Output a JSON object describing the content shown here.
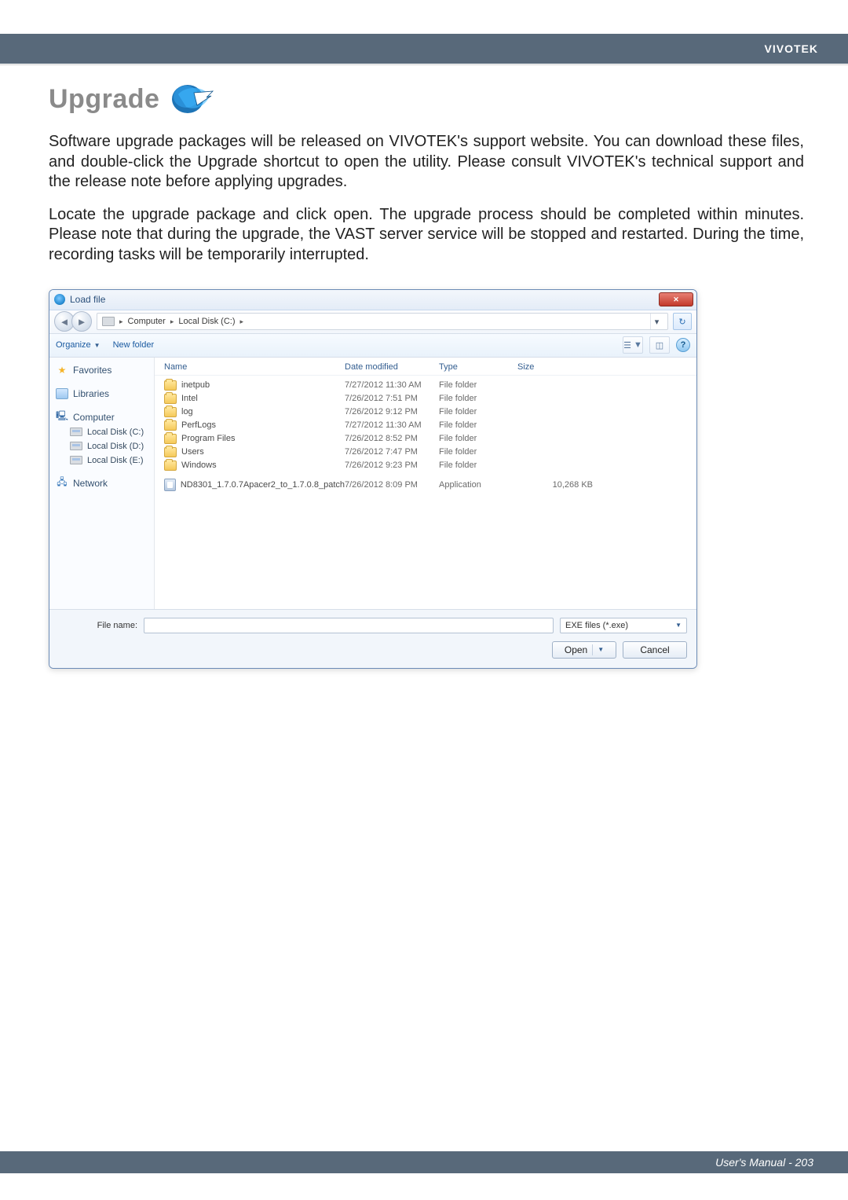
{
  "header": {
    "brand": "VIVOTEK"
  },
  "section": {
    "title": "Upgrade"
  },
  "paragraphs": {
    "p1": "Software upgrade packages will be released on VIVOTEK's support website. You can download these files, and double-click the Upgrade shortcut to open the utility. Please consult VIVOTEK's technical support and the release note before applying upgrades.",
    "p2": "Locate the upgrade package and click open. The upgrade process should be completed within minutes. Please note that during the upgrade, the VAST server service will be stopped and restarted. During the time, recording tasks will be temporarily interrupted."
  },
  "dialog": {
    "title": "Load file",
    "breadcrumb": {
      "root": "Computer",
      "drive": "Local Disk (C:)"
    },
    "toolbar": {
      "organize": "Organize",
      "newfolder": "New folder"
    },
    "nav": {
      "favorites": "Favorites",
      "libraries": "Libraries",
      "computer": "Computer",
      "drives": [
        "Local Disk (C:)",
        "Local Disk (D:)",
        "Local Disk (E:)"
      ],
      "network": "Network"
    },
    "columns": {
      "name": "Name",
      "date": "Date modified",
      "type": "Type",
      "size": "Size"
    },
    "files": [
      {
        "icon": "folder",
        "name": "inetpub",
        "date": "7/27/2012 11:30 AM",
        "type": "File folder",
        "size": ""
      },
      {
        "icon": "folder",
        "name": "Intel",
        "date": "7/26/2012 7:51 PM",
        "type": "File folder",
        "size": ""
      },
      {
        "icon": "folder",
        "name": "log",
        "date": "7/26/2012 9:12 PM",
        "type": "File folder",
        "size": ""
      },
      {
        "icon": "folder",
        "name": "PerfLogs",
        "date": "7/27/2012 11:30 AM",
        "type": "File folder",
        "size": ""
      },
      {
        "icon": "folder",
        "name": "Program Files",
        "date": "7/26/2012 8:52 PM",
        "type": "File folder",
        "size": ""
      },
      {
        "icon": "folder",
        "name": "Users",
        "date": "7/26/2012 7:47 PM",
        "type": "File folder",
        "size": ""
      },
      {
        "icon": "folder",
        "name": "Windows",
        "date": "7/26/2012 9:23 PM",
        "type": "File folder",
        "size": ""
      },
      {
        "icon": "app",
        "name": "ND8301_1.7.0.7Apacer2_to_1.7.0.8_patch",
        "date": "7/26/2012 8:09 PM",
        "type": "Application",
        "size": "10,268 KB"
      }
    ],
    "filename_label": "File name:",
    "filter": "EXE files (*.exe)",
    "open": "Open",
    "cancel": "Cancel"
  },
  "footer": {
    "text": "User's Manual - 203"
  }
}
